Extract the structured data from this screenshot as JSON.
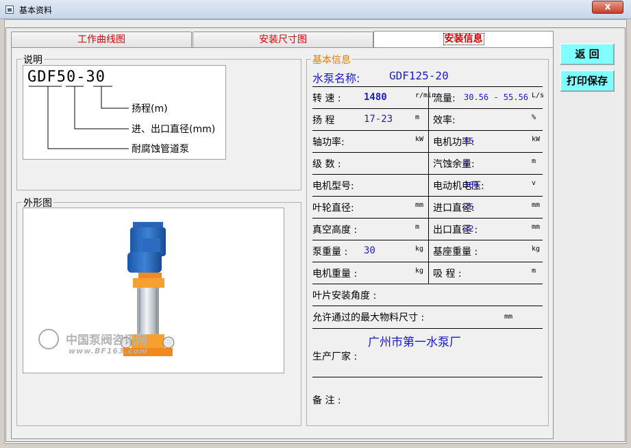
{
  "window": {
    "title": "基本资料",
    "close_label": "x"
  },
  "tabs": [
    {
      "label": "工作曲线图"
    },
    {
      "label": "安装尺寸图"
    },
    {
      "label": "安装信息"
    }
  ],
  "explain": {
    "legend": "说明",
    "model_parts": {
      "p1": "GDF",
      "p2": "50",
      "sep": "-",
      "p3": "30"
    },
    "labels": {
      "head": "扬程(m)",
      "diameter": "进、出口直径(mm)",
      "type": "耐腐蚀管道泵"
    }
  },
  "shape": {
    "legend": "外形图",
    "watermark_cn": "中国泵阀咨讯网",
    "watermark_url": "www.BF163.com"
  },
  "info": {
    "legend": "基本信息",
    "pump_name_label": "水泵名称:",
    "pump_name_value": "GDF125-20",
    "rows": [
      {
        "l_label": "转 速 :",
        "l_value": "1480",
        "l_unit": "r/min",
        "r_label": "流量:",
        "r_value": "30.56 - 55.56",
        "r_unit": "L/s"
      },
      {
        "l_label": "扬 程",
        "l_value": "17-23",
        "l_unit": "m",
        "r_label": "效率:",
        "r_value": "",
        "r_unit": "%"
      },
      {
        "l_label": "轴功率:",
        "l_value": "",
        "l_unit": "kW",
        "r_label": "电机功率:",
        "r_value": "15",
        "r_unit": "kW"
      },
      {
        "l_label": "级 数 :",
        "l_value": "",
        "l_unit": "",
        "r_label": "汽蚀余量:",
        "r_value": "4",
        "r_unit": "m"
      },
      {
        "l_label": "电机型号:",
        "l_value": "",
        "l_unit": "",
        "r_label": "电动机电压:",
        "r_value": "380",
        "r_unit": "v"
      },
      {
        "l_label": "叶轮直径:",
        "l_value": "",
        "l_unit": "mm",
        "r_label": "进口直径:",
        "r_value": "25",
        "r_unit": "mm"
      },
      {
        "l_label": "真空高度 :",
        "l_value": "",
        "l_unit": "m",
        "r_label": "出口直径 :",
        "r_value": "32",
        "r_unit": "mm"
      },
      {
        "l_label": "泵重量 :",
        "l_value": "30",
        "l_unit": "kg",
        "r_label": "基座重量 :",
        "r_value": "",
        "r_unit": "kg"
      },
      {
        "l_label": "电机重量 :",
        "l_value": "",
        "l_unit": "kg",
        "r_label": "吸 程 :",
        "r_value": "",
        "r_unit": "m"
      }
    ],
    "blade_angle_label": "叶片安装角度 :",
    "max_material_label": "允许通过的最大物料尺寸 :",
    "max_material_unit": "mm",
    "manufacturer_value": "广州市第一水泵厂",
    "manufacturer_label": "生产厂家 :",
    "remark_label": "备 注 :"
  },
  "buttons": {
    "back": "返 回",
    "print_save": "打印保存"
  },
  "colors": {
    "tab_text": "#d40000",
    "value_blue": "#1a1acd",
    "legend_orange": "#e07a00",
    "button_cyan": "#7fffff"
  }
}
